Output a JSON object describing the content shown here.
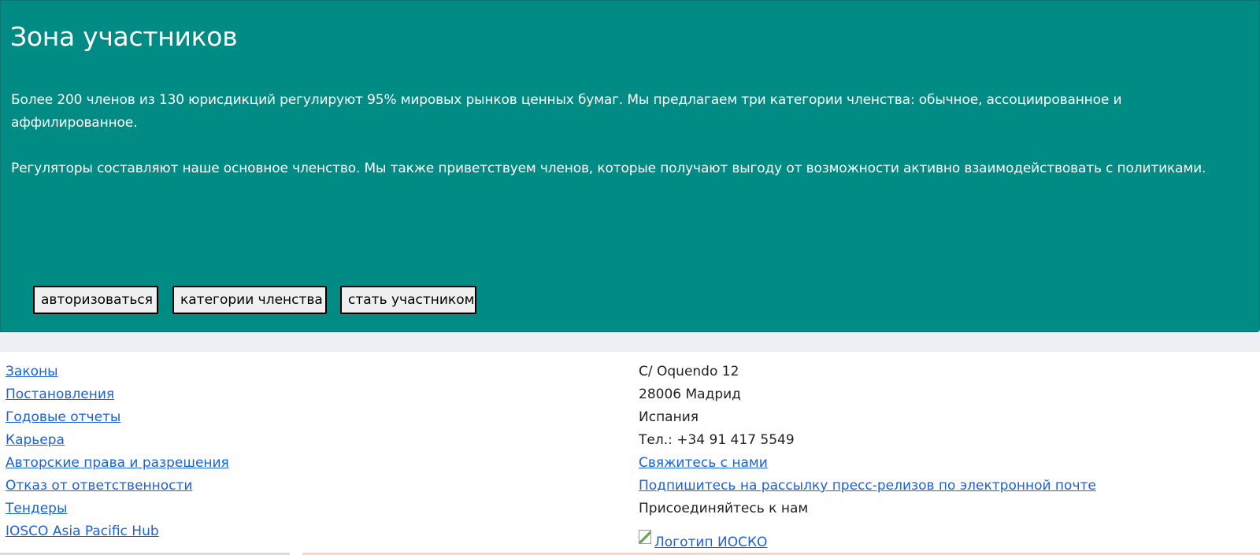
{
  "members_zone": {
    "title": "Зона участников",
    "paragraph_1": "Более 200 членов из 130 юрисдикций регулируют 95% мировых рынков ценных бумаг. Мы предлагаем три категории членства: обычное, ассоциированное и аффилированное.",
    "paragraph_2": "Регуляторы составляют наше основное членство. Мы также приветствуем членов, которые получают выгоду от возможности активно взаимодействовать с политиками.",
    "buttons": {
      "login": "авторизоваться",
      "categories": "категории членства",
      "join": "стать участником"
    },
    "background_color": "#008b84"
  },
  "footer": {
    "links": [
      "Законы",
      "Постановления",
      "Годовые отчеты",
      "Карьера",
      "Авторские права и разрешения",
      "Отказ от ответственности",
      "Тендеры",
      "IOSCO Asia Pacific Hub"
    ],
    "address": {
      "street": "C/ Oquendo 12",
      "city": "28006 Мадрид",
      "country": "Испания",
      "phone": "Тел.: +34 91 417 5549"
    },
    "contact_link": "Свяжитесь с нами",
    "subscribe_link": "Подпишитесь на рассылку пресс-релизов по электронной почте",
    "join_us": "Присоединяйтесь к нам",
    "logo_alt": "Логотип ИОСКО",
    "link_color": "#1a62d9"
  }
}
